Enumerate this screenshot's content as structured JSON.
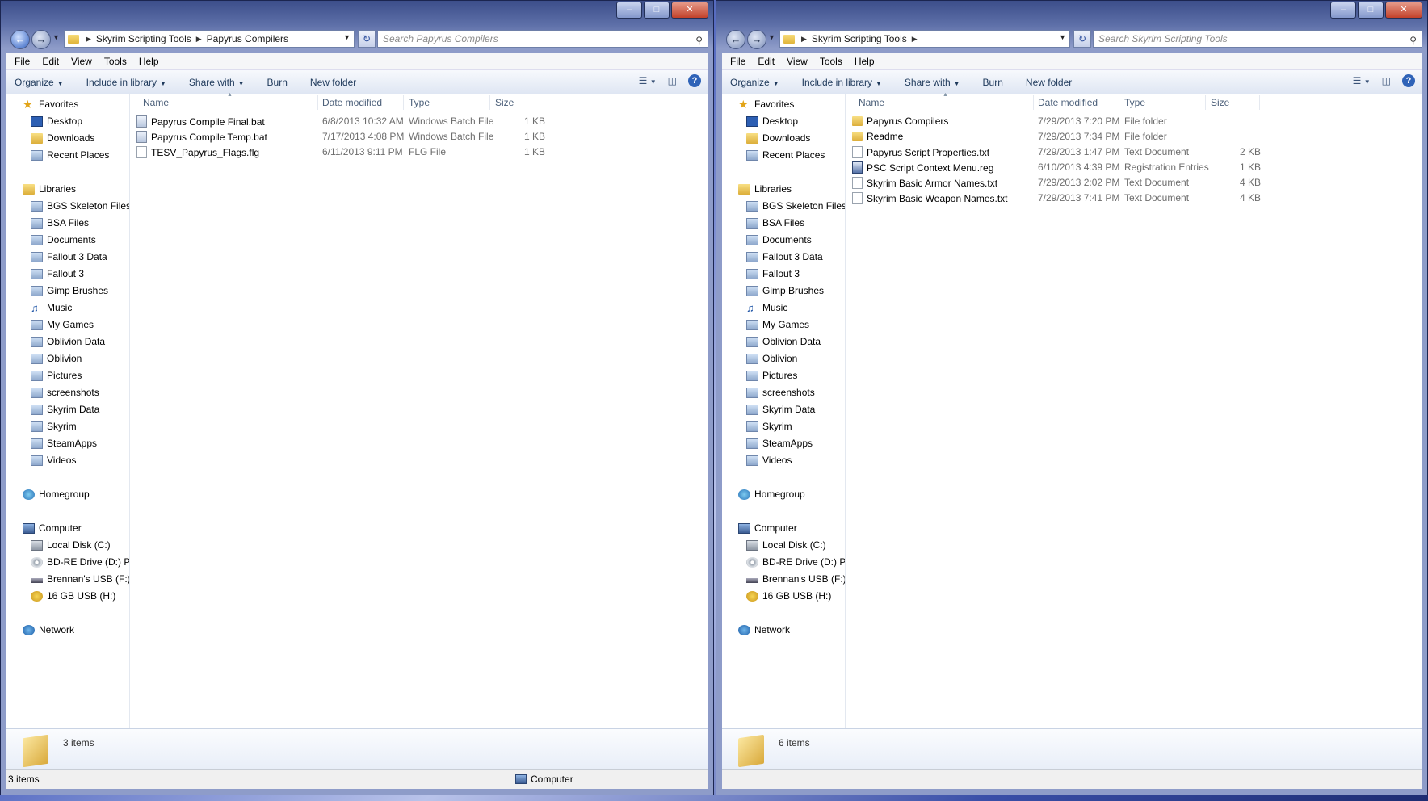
{
  "left_window": {
    "breadcrumb": [
      "Skyrim Scripting Tools",
      "Papyrus Compilers"
    ],
    "search_placeholder": "Search Papyrus Compilers",
    "menu": [
      "File",
      "Edit",
      "View",
      "Tools",
      "Help"
    ],
    "commands": {
      "organize": "Organize",
      "include": "Include in library",
      "share": "Share with",
      "burn": "Burn",
      "new_folder": "New folder"
    },
    "columns": {
      "name": "Name",
      "date": "Date modified",
      "type": "Type",
      "size": "Size"
    },
    "files": [
      {
        "name": "Papyrus Compile Final.bat",
        "date": "6/8/2013 10:32 AM",
        "type": "Windows Batch File",
        "size": "1 KB",
        "icon": "batch-file-icon"
      },
      {
        "name": "Papyrus Compile Temp.bat",
        "date": "7/17/2013 4:08 PM",
        "type": "Windows Batch File",
        "size": "1 KB",
        "icon": "batch-file-icon"
      },
      {
        "name": "TESV_Papyrus_Flags.flg",
        "date": "6/11/2013 9:11 PM",
        "type": "FLG File",
        "size": "1 KB",
        "icon": "document-icon"
      }
    ],
    "details_count": "3 items",
    "status_left": "3 items",
    "status_right": "Computer"
  },
  "right_window": {
    "breadcrumb": [
      "Skyrim Scripting Tools"
    ],
    "search_placeholder": "Search Skyrim Scripting Tools",
    "menu": [
      "File",
      "Edit",
      "View",
      "Tools",
      "Help"
    ],
    "commands": {
      "organize": "Organize",
      "include": "Include in library",
      "share": "Share with",
      "burn": "Burn",
      "new_folder": "New folder"
    },
    "columns": {
      "name": "Name",
      "date": "Date modified",
      "type": "Type",
      "size": "Size"
    },
    "files": [
      {
        "name": "Papyrus Compilers",
        "date": "7/29/2013 7:20 PM",
        "type": "File folder",
        "size": "",
        "icon": "folder-icon"
      },
      {
        "name": "Readme",
        "date": "7/29/2013 7:34 PM",
        "type": "File folder",
        "size": "",
        "icon": "folder-icon"
      },
      {
        "name": "Papyrus Script Properties.txt",
        "date": "7/29/2013 1:47 PM",
        "type": "Text Document",
        "size": "2 KB",
        "icon": "text-document-icon"
      },
      {
        "name": "PSC Script Context Menu.reg",
        "date": "6/10/2013 4:39 PM",
        "type": "Registration Entries",
        "size": "1 KB",
        "icon": "registry-icon"
      },
      {
        "name": "Skyrim Basic Armor Names.txt",
        "date": "7/29/2013 2:02 PM",
        "type": "Text Document",
        "size": "4 KB",
        "icon": "text-document-icon"
      },
      {
        "name": "Skyrim Basic Weapon Names.txt",
        "date": "7/29/2013 7:41 PM",
        "type": "Text Document",
        "size": "4 KB",
        "icon": "text-document-icon"
      }
    ],
    "details_count": "6 items",
    "status_left": "",
    "status_right": ""
  },
  "nav": {
    "favorites": "Favorites",
    "favorites_items": [
      "Desktop",
      "Downloads",
      "Recent Places"
    ],
    "libraries": "Libraries",
    "libraries_items": [
      "BGS Skeleton Files",
      "BSA Files",
      "Documents",
      "Fallout 3 Data",
      "Fallout 3",
      "Gimp Brushes",
      "Music",
      "My Games",
      "Oblivion Data",
      "Oblivion",
      "Pictures",
      "screenshots",
      "Skyrim Data",
      "Skyrim",
      "SteamApps",
      "Videos"
    ],
    "homegroup": "Homegroup",
    "computer": "Computer",
    "computer_items": [
      "Local Disk (C:)",
      "BD-RE Drive (D:) PR",
      "Brennan's USB (F:)",
      "16 GB USB (H:)"
    ],
    "network": "Network"
  }
}
